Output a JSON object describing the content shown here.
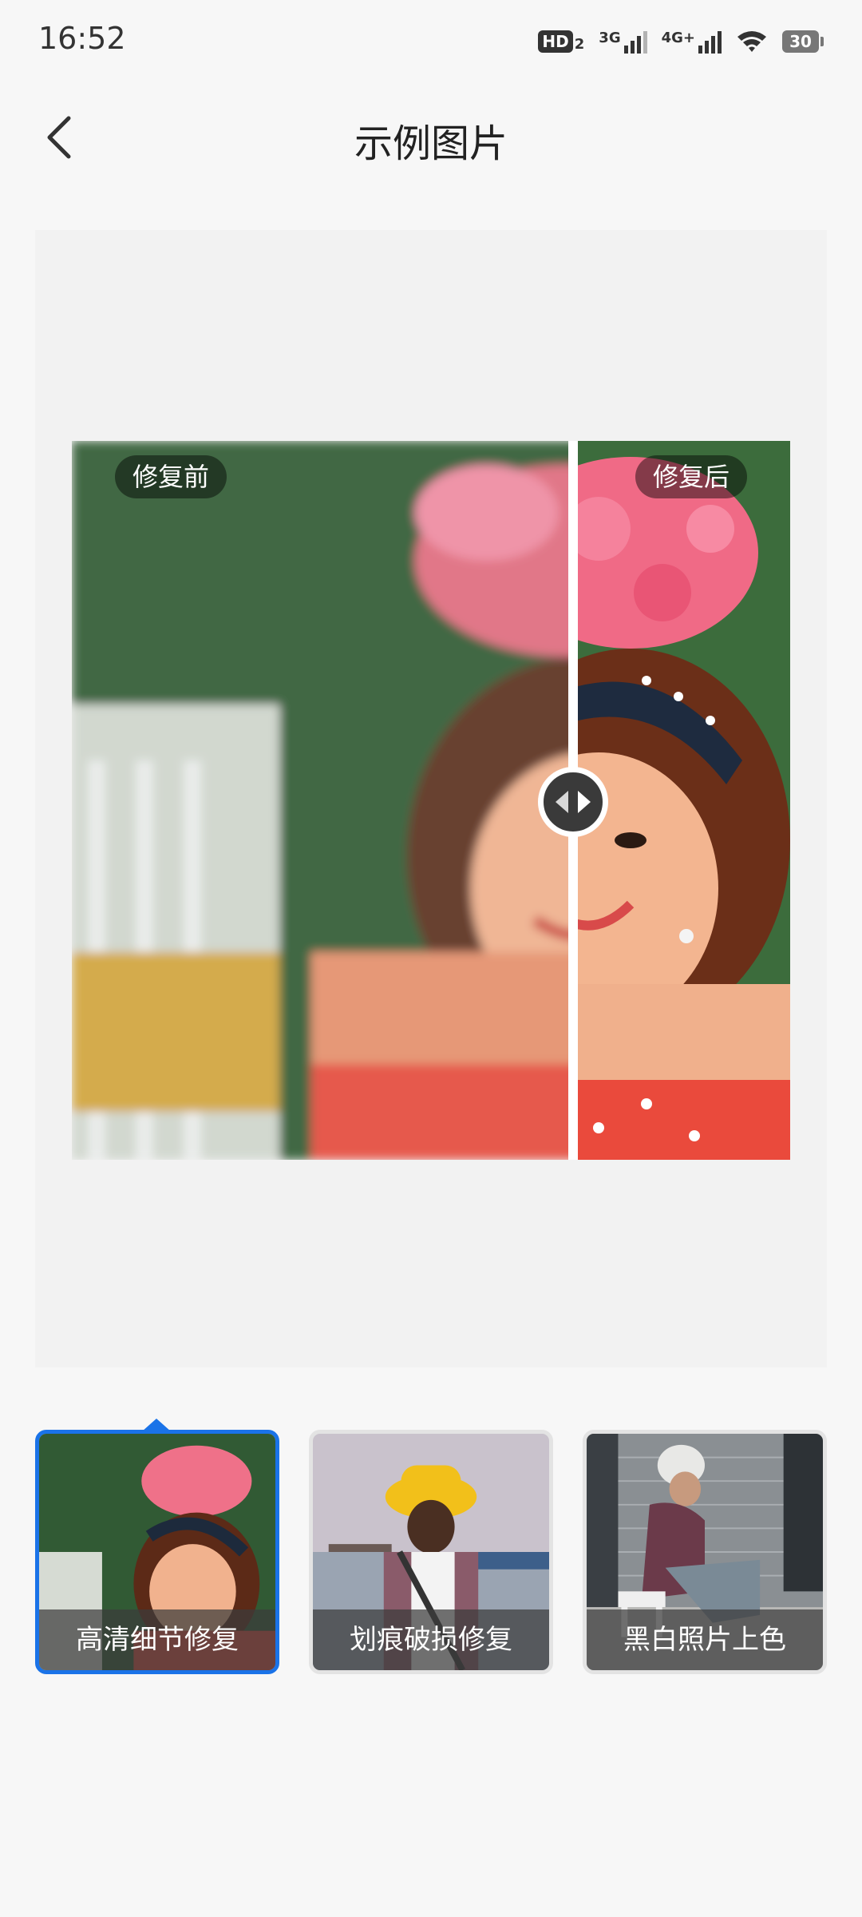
{
  "status_bar": {
    "time": "16:52",
    "hd_label": "HD",
    "hd_sub": "2",
    "net1": "3G",
    "net2": "4G+",
    "battery": "30",
    "icons": [
      "hd-voice-icon",
      "signal-3g-icon",
      "signal-4g-icon",
      "wifi-icon",
      "battery-icon"
    ]
  },
  "header": {
    "back_icon": "back-arrow-icon",
    "title": "示例图片"
  },
  "compare": {
    "before_label": "修复前",
    "after_label": "修复后",
    "handle_icon": "compare-slider-handle-icon",
    "slider_position": 0.69
  },
  "thumbnails": [
    {
      "label": "高清细节修复",
      "selected": true
    },
    {
      "label": "划痕破损修复",
      "selected": false
    },
    {
      "label": "黑白照片上色",
      "selected": false
    }
  ],
  "colors": {
    "accent": "#1a73e8",
    "background": "#f7f7f7"
  }
}
